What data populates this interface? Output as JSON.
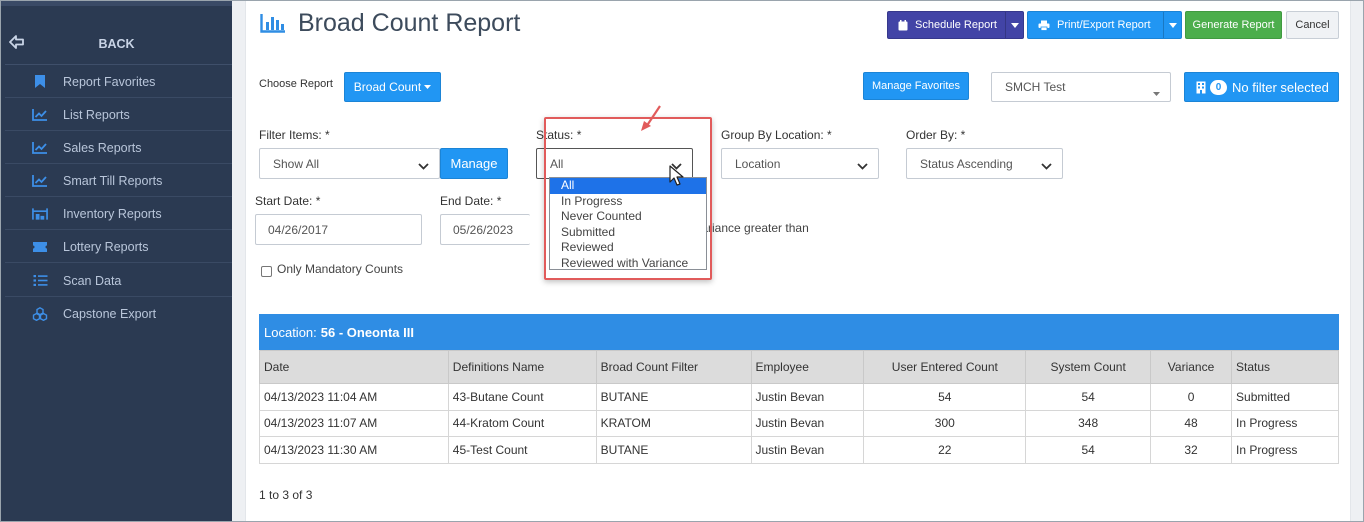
{
  "sidebar": {
    "back_label": "BACK",
    "items": [
      {
        "label": "Report Favorites",
        "icon": "bookmark-icon"
      },
      {
        "label": "List Reports",
        "icon": "line-chart-icon"
      },
      {
        "label": "Sales Reports",
        "icon": "line-chart-icon"
      },
      {
        "label": "Smart Till Reports",
        "icon": "line-chart-icon"
      },
      {
        "label": "Inventory Reports",
        "icon": "warehouse-icon"
      },
      {
        "label": "Lottery Reports",
        "icon": "ticket-icon"
      },
      {
        "label": "Scan Data",
        "icon": "list-icon"
      },
      {
        "label": "Capstone Export",
        "icon": "cubes-icon"
      }
    ]
  },
  "header": {
    "title": "Broad Count Report",
    "schedule_label": "Schedule Report",
    "print_label": "Print/Export Report",
    "generate_label": "Generate Report",
    "cancel_label": "Cancel"
  },
  "toolbar": {
    "choose_report_label": "Choose Report",
    "report_value": "Broad Count",
    "manage_favorites_label": "Manage Favorites",
    "store_value": "SMCH Test",
    "filter_count": "0",
    "filter_label": "No filter selected"
  },
  "filters": {
    "filter_items_label": "Filter Items: *",
    "filter_items_value": "Show All",
    "manage_label": "Manage",
    "status_label": "Status: *",
    "status_value": "All",
    "status_options": [
      "All",
      "In Progress",
      "Never Counted",
      "Submitted",
      "Reviewed",
      "Reviewed with Variance"
    ],
    "group_by_label": "Group By Location: *",
    "group_by_value": "Location",
    "order_by_label": "Order By: *",
    "order_by_value": "Status Ascending",
    "start_date_label": "Start Date: *",
    "start_date_value": "04/26/2017",
    "end_date_label": "End Date: *",
    "end_date_value": "05/26/2023",
    "variance_text": "th variance greater than",
    "mandatory_label": "Only Mandatory Counts"
  },
  "table": {
    "location_prefix": "Location:",
    "location_name": "56 - Oneonta III",
    "columns": [
      "Date",
      "Definitions Name",
      "Broad Count Filter",
      "Employee",
      "User Entered Count",
      "System Count",
      "Variance",
      "Status"
    ],
    "rows": [
      [
        "04/13/2023 11:04 AM",
        "43-Butane Count",
        "BUTANE",
        "Justin Bevan",
        "54",
        "54",
        "0",
        "Submitted"
      ],
      [
        "04/13/2023 11:07 AM",
        "44-Kratom Count",
        "KRATOM",
        "Justin Bevan",
        "300",
        "348",
        "48",
        "In Progress"
      ],
      [
        "04/13/2023 11:30 AM",
        "45-Test Count",
        "BUTANE",
        "Justin Bevan",
        "22",
        "54",
        "32",
        "In Progress"
      ]
    ],
    "pager_text": "1 to 3 of 3"
  },
  "colors": {
    "sidebar_bg": "#2b3a52",
    "primary_blue": "#2196f3",
    "schedule_purple": "#4244a6",
    "generate_green": "#4cae4c",
    "highlight_red": "#e15b5b",
    "selected_option": "#1e72e8"
  }
}
